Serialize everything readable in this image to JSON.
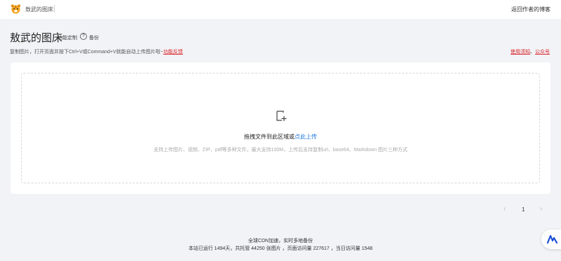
{
  "topbar": {
    "site_name": "敖武的图床",
    "back_link": "返回作者的博客"
  },
  "header": {
    "title": "敖武的图床",
    "customize": "功能定制",
    "help_icon": "?",
    "backup": "备份"
  },
  "hint": {
    "text": "复制图片，打开页面并按下Ctrl+V或Command+V就能自动上传图片啦~",
    "feedback_link": "功能反馈"
  },
  "right_links": {
    "usage": "使用须知",
    "sep": "、",
    "official": "公众号"
  },
  "upload": {
    "drop_text": "拖拽文件到此区域或",
    "click_upload": "点此上传",
    "sub_text": "支持上传图片、视频、ZIP、pdf等多种文件，最大支持100M，上传后支持复制url、base64、Markdown 图片三种方式"
  },
  "pagination": {
    "prev": "‹",
    "current": "1",
    "next": "›"
  },
  "footer": {
    "line1": "全球CDN加速，实时多地备份",
    "line2": "本站已运行 1494天，共托管 44250 张图片 ，页面访问量 227617 ，当日访问量 1548"
  },
  "colors": {
    "accent_link": "#d9262c",
    "upload_blue": "#1e7ae0",
    "float_logo": "#1f4fd6"
  },
  "icons": {
    "logo": "tiger-logo-icon",
    "upload": "upload-plus-icon",
    "help": "question-circle-icon",
    "float": "brand-badge-icon"
  }
}
